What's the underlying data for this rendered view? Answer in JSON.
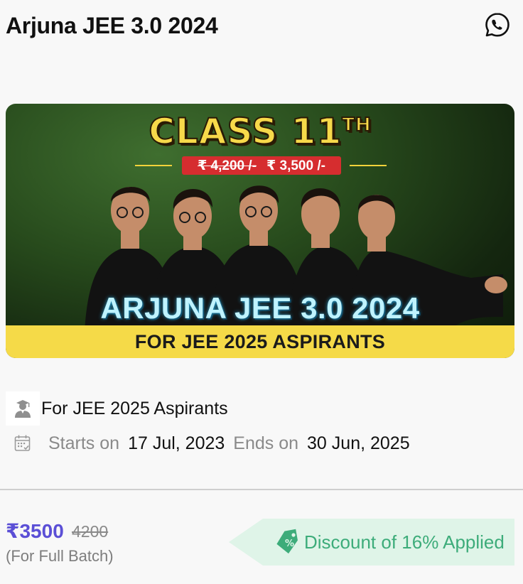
{
  "header": {
    "title": "Arjuna JEE 3.0 2024",
    "share_icon": "whatsapp-icon"
  },
  "banner": {
    "class_label": "CLASS 11",
    "class_suffix": "TH",
    "old_price": "₹ 4,200 /-",
    "new_price": "₹ 3,500 /-",
    "course_name": "ARJUNA JEE 3.0 2024",
    "strip_text": "FOR JEE 2025 ASPIRANTS",
    "colors": {
      "title": "#f7d94a",
      "price_bg": "#d62d2f",
      "strip": "#f5da48"
    }
  },
  "details": {
    "audience_icon": "student-icon",
    "audience": "For JEE 2025 Aspirants",
    "calendar_icon": "calendar-icon",
    "starts_label": "Starts on",
    "starts_date": "17 Jul, 2023",
    "ends_label": "Ends on",
    "ends_date": "30 Jun, 2025"
  },
  "pricing": {
    "price": "₹3500",
    "original_price": "4200",
    "note": "(For Full Batch)",
    "discount_icon": "discount-tag-icon",
    "discount_text": "Discount of 16% Applied",
    "colors": {
      "price": "#5b4fd6",
      "discount_bg": "#dff4e8",
      "discount_text": "#3dac7a"
    }
  }
}
